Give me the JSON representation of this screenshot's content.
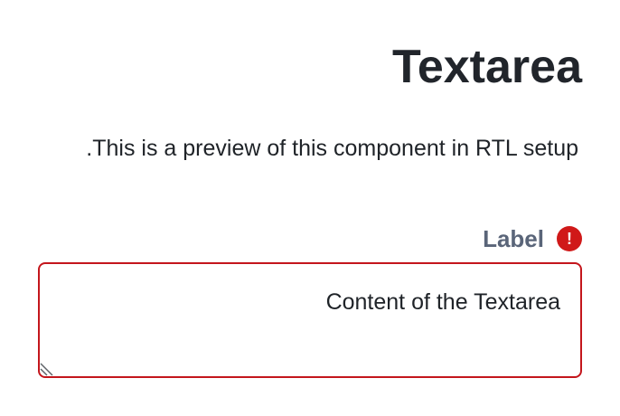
{
  "page": {
    "title": "Textarea",
    "description": ".This is a preview of this component in RTL setup"
  },
  "field": {
    "label": "Label",
    "error_icon": "exclamation-icon",
    "error_symbol": "!",
    "value": "Content of the Textarea",
    "state": "error",
    "error_color": "#d01919"
  }
}
